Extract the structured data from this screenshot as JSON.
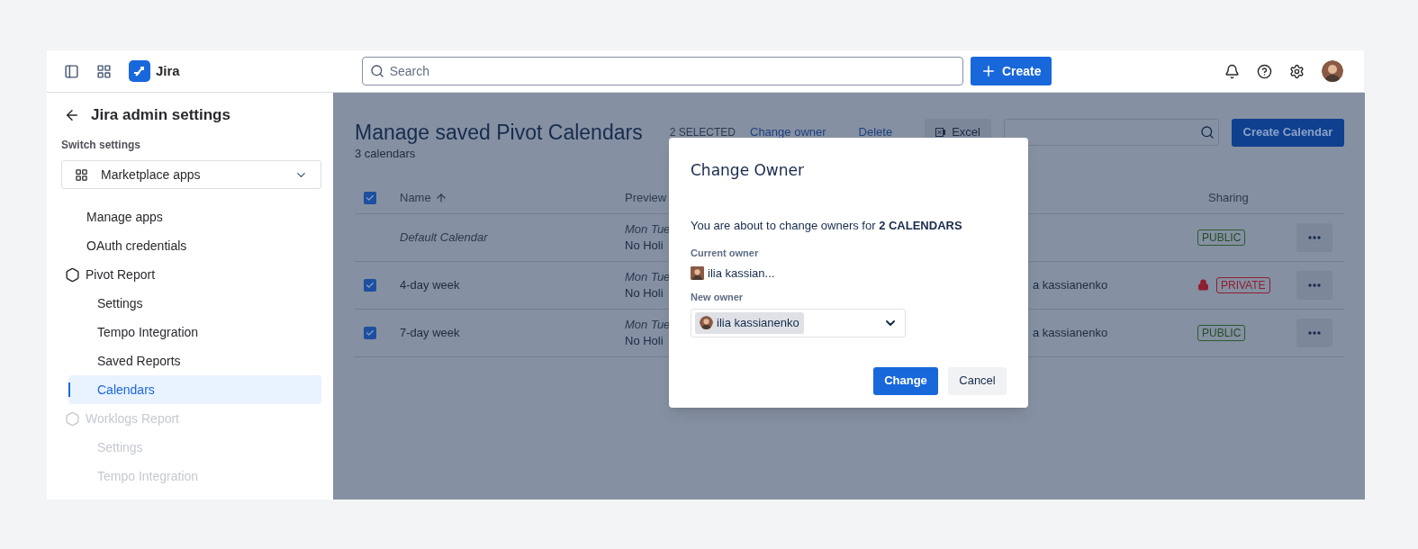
{
  "topbar": {
    "product": "Jira",
    "search": {
      "placeholder": "Search"
    },
    "create": "Create"
  },
  "sidebar": {
    "title": "Jira admin settings",
    "switch_label": "Switch settings",
    "switch_value": "Marketplace apps",
    "items": [
      {
        "label": "Manage apps",
        "selected": false,
        "disabled": false
      },
      {
        "label": "OAuth credentials",
        "selected": false,
        "disabled": false
      },
      {
        "label": "Pivot Report",
        "selected": false,
        "disabled": false,
        "children": [
          {
            "label": "Settings",
            "selected": false,
            "disabled": false
          },
          {
            "label": "Tempo Integration",
            "selected": false,
            "disabled": false
          },
          {
            "label": "Saved Reports",
            "selected": false,
            "disabled": false
          },
          {
            "label": "Calendars",
            "selected": true,
            "disabled": false
          }
        ]
      },
      {
        "label": "Worklogs Report",
        "selected": false,
        "disabled": true,
        "children": [
          {
            "label": "Settings",
            "selected": false,
            "disabled": true
          },
          {
            "label": "Tempo Integration",
            "selected": false,
            "disabled": true
          }
        ]
      }
    ]
  },
  "main": {
    "title": "Manage saved Pivot Calendars",
    "subtitle": "3 calendars",
    "selected_count": "2 SELECTED",
    "actions": [
      "Change owner",
      "Delete"
    ],
    "excel": "Excel",
    "create_calendar": "Create Calendar",
    "table": {
      "all_checked": true,
      "columns": [
        "Name",
        "Preview",
        "Sharing"
      ],
      "rows": [
        {
          "kind": "default",
          "name": "Default Calendar",
          "preview": [
            "Mon Tue",
            "No Holi"
          ],
          "sharing": {
            "kind": "public",
            "label": "PUBLIC"
          }
        },
        {
          "kind": "custom",
          "checked": true,
          "name": "4-day week",
          "preview": [
            "Mon Tue",
            "No Holi"
          ],
          "owner": "a kassianenko",
          "sharing": {
            "kind": "private",
            "label": "PRIVATE"
          }
        },
        {
          "kind": "custom",
          "checked": true,
          "name": "7-day week",
          "preview": [
            "Mon Tue",
            "No Holi"
          ],
          "owner": "a kassianenko",
          "sharing": {
            "kind": "public",
            "label": "PUBLIC"
          }
        }
      ]
    }
  },
  "dialog": {
    "title": "Change Owner",
    "message": "You are about to change owners for **2 CALENDARS**",
    "current_label": "Current owner",
    "current_owner": "ilia kassian...",
    "new_label": "New owner",
    "new_owner": "ilia kassianenko",
    "buttons": [
      {
        "label": "Change",
        "kind": "primary"
      },
      {
        "label": "Cancel",
        "kind": "secondary"
      }
    ]
  }
}
